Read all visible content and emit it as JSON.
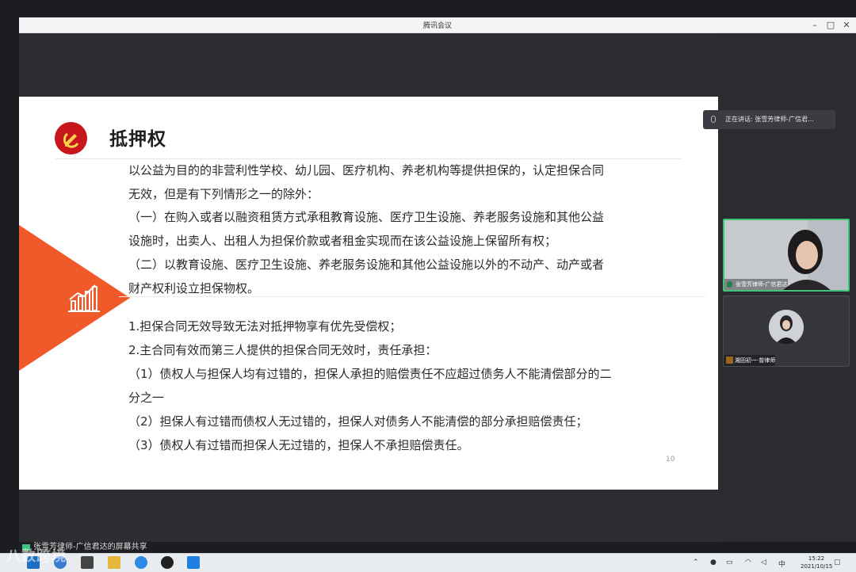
{
  "window": {
    "title": "腾讯会议",
    "minimize": "–",
    "maximize": "□",
    "close": "✕"
  },
  "slide": {
    "title": "抵押权",
    "page_number": "10",
    "paragraphs": [
      "以公益为目的的非营利性学校、幼儿园、医疗机构、养老机构等提供担保的，认定担保合同",
      "无效，但是有下列情形之一的除外：",
      "（一）在购入或者以融资租赁方式承租教育设施、医疗卫生设施、养老服务设施和其他公益",
      "设施时，出卖人、出租人为担保价款或者租金实现而在该公益设施上保留所有权；",
      "（二）以教育设施、医疗卫生设施、养老服务设施和其他公益设施以外的不动产、动产或者",
      "财产权利设立担保物权。"
    ],
    "items": [
      "1.担保合同无效导致无法对抵押物享有优先受偿权；",
      "2.主合同有效而第三人提供的担保合同无效时，责任承担：",
      "（1）债权人与担保人均有过错的，担保人承担的赔偿责任不应超过债务人不能清偿部分的二",
      "分之一",
      "（2）担保人有过错而债权人无过错的，担保人对债务人不能清偿的部分承担赔偿责任；",
      "（3）债权人有过错而担保人无过错的，担保人不承担赔偿责任。"
    ]
  },
  "side_panel": {
    "speaking_label": "正在讲话: 张雪芳律师-广信君...",
    "participants": [
      {
        "name": "张雪芳律师-广信君达"
      },
      {
        "name": "湘田初一·曾律师"
      }
    ]
  },
  "share_label": "张雪芳律师-广信君达的屏幕共享",
  "watermark": "八数跨境",
  "taskbar": {
    "time": "15:22",
    "date": "2021/10/15",
    "ime": "中"
  },
  "colors": {
    "accent_orange": "#f05a2a",
    "emblem_red": "#c7161c",
    "speaking_green": "#3cc47a"
  }
}
